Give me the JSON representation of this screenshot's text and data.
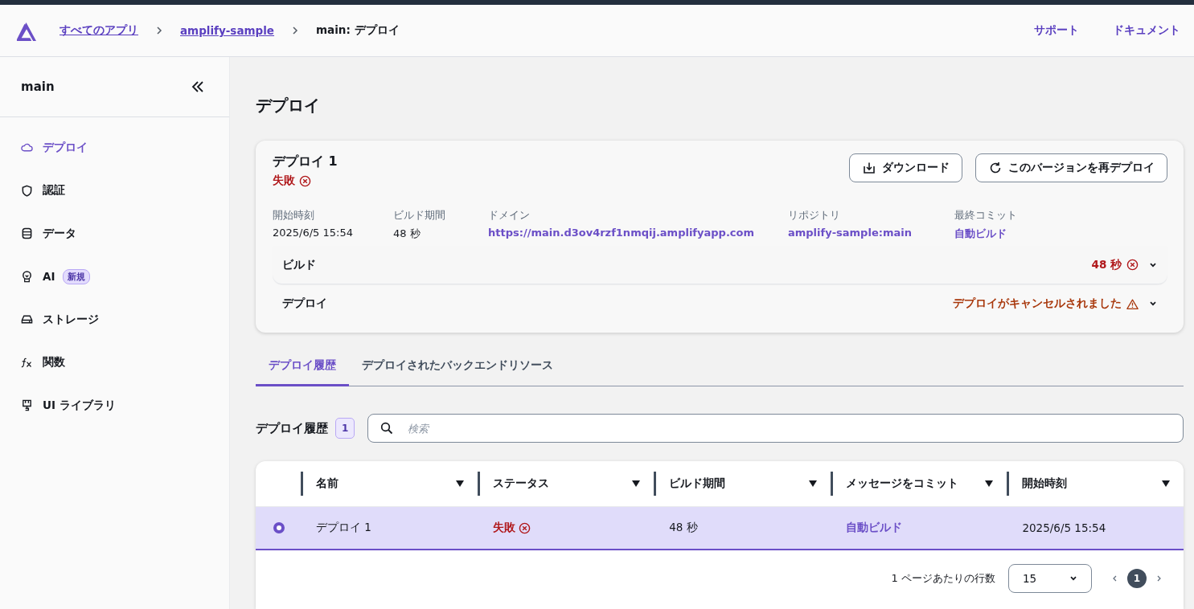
{
  "breadcrumbs": [
    {
      "label": "すべてのアプリ",
      "kind": "link"
    },
    {
      "label": "amplify-sample",
      "kind": "link"
    },
    {
      "label": "main: デプロイ",
      "kind": "current"
    }
  ],
  "header_links": [
    "サポート",
    "ドキュメント"
  ],
  "sidebar": {
    "title": "main",
    "items": [
      {
        "label": "デプロイ",
        "kind": "cloud",
        "selected": true
      },
      {
        "label": "認証",
        "kind": "shield",
        "selected": false
      },
      {
        "label": "データ",
        "kind": "database",
        "selected": false
      },
      {
        "label": "AI",
        "kind": "bulb",
        "selected": false,
        "badge": "新規"
      },
      {
        "label": "ストレージ",
        "kind": "drive",
        "selected": false
      },
      {
        "label": "関数",
        "kind": "fx",
        "selected": false
      },
      {
        "label": "UI ライブラリ",
        "kind": "plug",
        "selected": false
      }
    ]
  },
  "page_title": "デプロイ",
  "deployment": {
    "title": "デプロイ 1",
    "status": {
      "label": "失敗",
      "kind": "error"
    },
    "buttons": [
      {
        "label": "ダウンロード",
        "kind": "download"
      },
      {
        "label": "このバージョンを再デプロイ",
        "kind": "refresh"
      }
    ],
    "details": [
      {
        "label": "開始時刻",
        "value": "2025/6/5 15:54",
        "kind": "text"
      },
      {
        "label": "ビルド期間",
        "value": "48 秒",
        "kind": "text"
      },
      {
        "label": "ドメイン",
        "value": "https://main.d3ov4rzf1nmqij.amplifyapp.com",
        "kind": "link"
      },
      {
        "label": "リポジトリ",
        "value": "amplify-sample:main",
        "kind": "link"
      },
      {
        "label": "最終コミット",
        "value": "自動ビルド",
        "kind": "link"
      }
    ],
    "steps": [
      {
        "name": "ビルド",
        "status": "48 秒",
        "kind": "error",
        "expanded": false
      },
      {
        "name": "デプロイ",
        "status": "デプロイがキャンセルされました",
        "kind": "warning",
        "expanded": false
      }
    ]
  },
  "tabs": [
    {
      "label": "デプロイ履歴",
      "selected": true
    },
    {
      "label": "デプロイされたバックエンドリソース",
      "selected": false
    }
  ],
  "history": {
    "title": "デプロイ履歴",
    "count": "1",
    "search": {
      "placeholder": "検索"
    },
    "columns": [
      "名前",
      "ステータス",
      "ビルド期間",
      "メッセージをコミット",
      "開始時刻"
    ],
    "rows": [
      {
        "selected": true,
        "cells": [
          {
            "text": "デプロイ 1",
            "kind": "text"
          },
          {
            "text": "失敗",
            "kind": "error"
          },
          {
            "text": "48 秒",
            "kind": "text"
          },
          {
            "text": "自動ビルド",
            "kind": "link"
          },
          {
            "text": "2025/6/5 15:54",
            "kind": "text"
          }
        ]
      }
    ],
    "pagination": {
      "label": "1 ページあたりの行数",
      "page_size": "15",
      "pages": [
        {
          "label": "1",
          "selected": true
        }
      ]
    }
  }
}
